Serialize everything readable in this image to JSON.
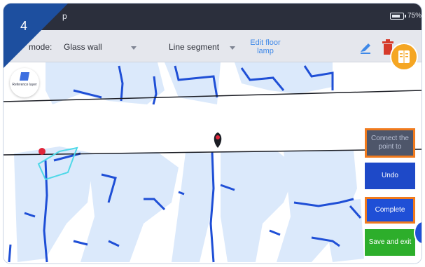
{
  "status": {
    "title": "p",
    "battery": "75%"
  },
  "toolbar": {
    "mode_label": "mode:",
    "mode_value": "Glass wall",
    "line_value": "Line segment",
    "edit_label": "Edit floor lamp"
  },
  "step": {
    "number": "4"
  },
  "map": {
    "reference_label": "Reference layer"
  },
  "buttons": {
    "connect": "Connect the point to",
    "undo": "Undo",
    "complete": "Complete",
    "save": "Save and exit"
  },
  "colors": {
    "badge": "#1d4f9f",
    "highlight": "#f07a1d",
    "undo": "#1e49c8",
    "complete": "#1f4fd6",
    "save": "#2dae2b",
    "book": "#f5a623"
  },
  "icons": [
    "pen-icon",
    "trash-icon",
    "book-icon",
    "layers-icon",
    "location-pin-icon"
  ]
}
